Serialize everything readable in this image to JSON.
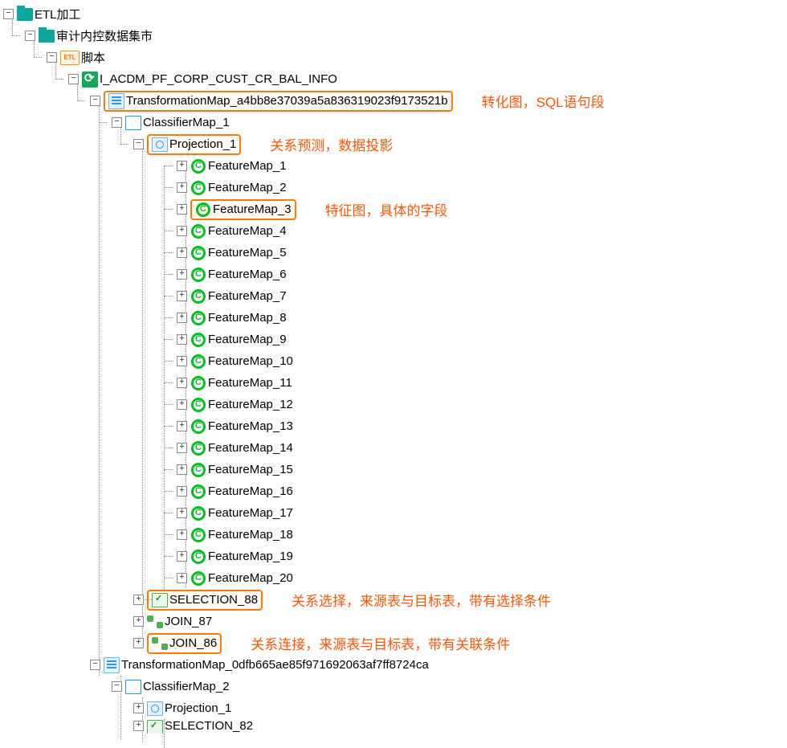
{
  "root": {
    "label": "ETL加工",
    "child": {
      "label": "审计内控数据集市",
      "child": {
        "label": "脚本",
        "etl_icon_text": "ETL",
        "child": {
          "label": "I_ACDM_PF_CORP_CUST_CR_BAL_INFO",
          "transformation_map_1": {
            "label": "TransformationMap_a4bb8e37039a5a836319023f9173521b",
            "annotation": "转化图，SQL语句段",
            "classifier": {
              "label": "ClassifierMap_1",
              "projection": {
                "label": "Projection_1",
                "annotation": "关系预测，数据投影",
                "features": [
                  "FeatureMap_1",
                  "FeatureMap_2",
                  "FeatureMap_3",
                  "FeatureMap_4",
                  "FeatureMap_5",
                  "FeatureMap_6",
                  "FeatureMap_7",
                  "FeatureMap_8",
                  "FeatureMap_9",
                  "FeatureMap_10",
                  "FeatureMap_11",
                  "FeatureMap_12",
                  "FeatureMap_13",
                  "FeatureMap_14",
                  "FeatureMap_15",
                  "FeatureMap_16",
                  "FeatureMap_17",
                  "FeatureMap_18",
                  "FeatureMap_19",
                  "FeatureMap_20"
                ],
                "feature_annotation_index": 2,
                "feature_annotation": "特征图，具体的字段"
              },
              "selection": {
                "label": "SELECTION_88",
                "annotation": "关系选择，来源表与目标表，带有选择条件"
              },
              "join87": {
                "label": "JOIN_87"
              },
              "join86": {
                "label": "JOIN_86",
                "annotation": "关系连接，来源表与目标表，带有关联条件"
              }
            }
          },
          "transformation_map_2": {
            "label": "TransformationMap_0dfb665ae85f971692063af7ff8724ca",
            "classifier": {
              "label": "ClassifierMap_2",
              "projection": {
                "label": "Projection_1"
              },
              "selection_partial": {
                "label": "SELECTION_82"
              }
            }
          }
        }
      }
    }
  }
}
